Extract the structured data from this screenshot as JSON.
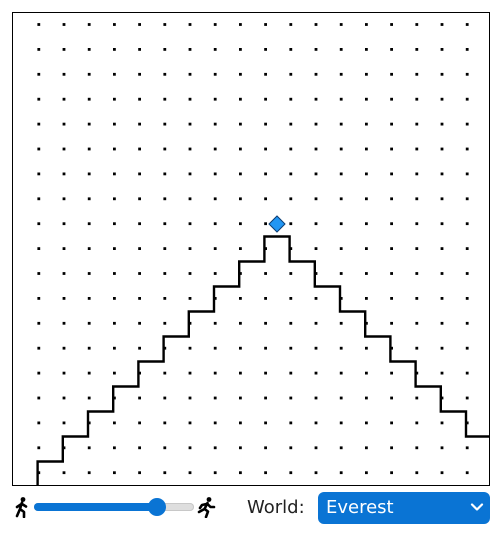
{
  "world": {
    "cols": 19,
    "rows": 19,
    "background": "#ffffff",
    "border_color": "#000000",
    "dot_color": "#000000",
    "path_color": "#000000",
    "beeper_color": "#2196f3",
    "mountain_heights": [
      0,
      1,
      2,
      3,
      4,
      5,
      6,
      7,
      8,
      9,
      8,
      7,
      6,
      5,
      4,
      3,
      2,
      1,
      0
    ],
    "goal_marker": {
      "col": 9,
      "row_from_bottom": 9,
      "shape": "diamond",
      "color": "#2196f3"
    },
    "robot": {
      "col": 18,
      "row_from_bottom": 0,
      "icon": "robot-icon"
    }
  },
  "controls": {
    "slow_icon": "walking-icon",
    "fast_icon": "running-icon",
    "speed_value": 0.77,
    "slider_color": "#0a74d4",
    "world_label": "World:",
    "world_selected": "Everest",
    "select_color": "#0a74d4"
  }
}
